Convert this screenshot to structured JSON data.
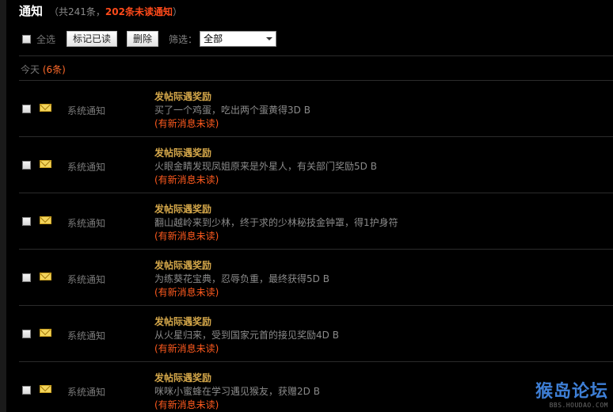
{
  "header": {
    "title": "通知",
    "summary_prefix": "（共241条，",
    "unread_count_text": "202条未读通知",
    "summary_suffix": "）"
  },
  "toolbar": {
    "select_all_label": "全选",
    "mark_read_label": "标记已读",
    "delete_label": "删除",
    "filter_label": "筛选：",
    "filter_value": "全部"
  },
  "group": {
    "label": "今天",
    "count": "(6条)"
  },
  "notifications": [
    {
      "sender": "系统通知",
      "subject": "发帖际遇奖励",
      "body": "买了一个鸡蛋，吃出两个蛋黄得3D B",
      "status": "(有新消息未读)"
    },
    {
      "sender": "系统通知",
      "subject": "发帖际遇奖励",
      "body": "火眼金睛发现凤姐原来是外星人，有关部门奖励5D B",
      "status": "(有新消息未读)"
    },
    {
      "sender": "系统通知",
      "subject": "发帖际遇奖励",
      "body": "翻山越岭来到少林，终于求的少林秘技金钟罩，得1护身符",
      "status": "(有新消息未读)"
    },
    {
      "sender": "系统通知",
      "subject": "发帖际遇奖励",
      "body": "为练葵花宝典，忍辱负重，最终获得5D B",
      "status": "(有新消息未读)"
    },
    {
      "sender": "系统通知",
      "subject": "发帖际遇奖励",
      "body": "从火星归来，受到国家元首的接见奖励4D B",
      "status": "(有新消息未读)"
    },
    {
      "sender": "系统通知",
      "subject": "发帖际遇奖励",
      "body": "咪咪小蜜蜂在学习遇见猴友，获赠2D B",
      "status": "(有新消息未读)"
    }
  ],
  "watermark": {
    "logo": "猴岛论坛",
    "url": "BBS.HOUDAO.COM"
  },
  "colors": {
    "background": "#000000",
    "subject": "#d4a74a",
    "unread": "#ff5a1e",
    "muted_text": "#8a8a8a",
    "divider": "#2b2b2b"
  }
}
